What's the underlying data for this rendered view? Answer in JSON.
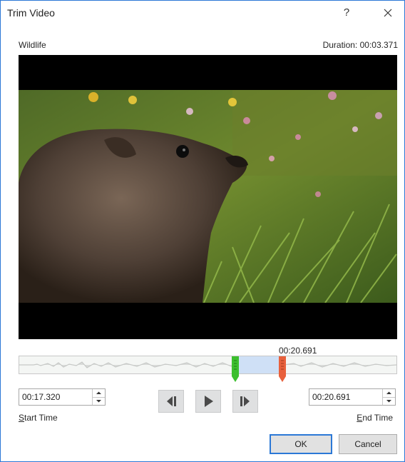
{
  "dialog": {
    "title": "Trim Video",
    "help_label": "?",
    "video_name": "Wildlife",
    "duration": "Duration: 00:03.371"
  },
  "timeline": {
    "marker_time": "00:20.691",
    "start_fraction": 0.57,
    "end_fraction": 0.69
  },
  "start": {
    "value": "00:17.320",
    "label_prefix": "S",
    "label_rest": "tart Time"
  },
  "end": {
    "value": "00:20.691",
    "label_prefix": "E",
    "label_rest": "nd Time"
  },
  "buttons": {
    "ok": "OK",
    "cancel": "Cancel"
  },
  "icons": {
    "help": "help-icon",
    "close": "close-icon",
    "prev_frame": "previous-frame-icon",
    "play": "play-icon",
    "next_frame": "next-frame-icon",
    "spin_up": "spin-up-icon",
    "spin_down": "spin-down-icon",
    "start_marker": "start-marker-icon",
    "end_marker": "end-marker-icon"
  },
  "colors": {
    "accent": "#2b78d6",
    "start_marker": "#3cbf2f",
    "end_marker": "#e8603c",
    "selection": "#cfe0f6"
  }
}
